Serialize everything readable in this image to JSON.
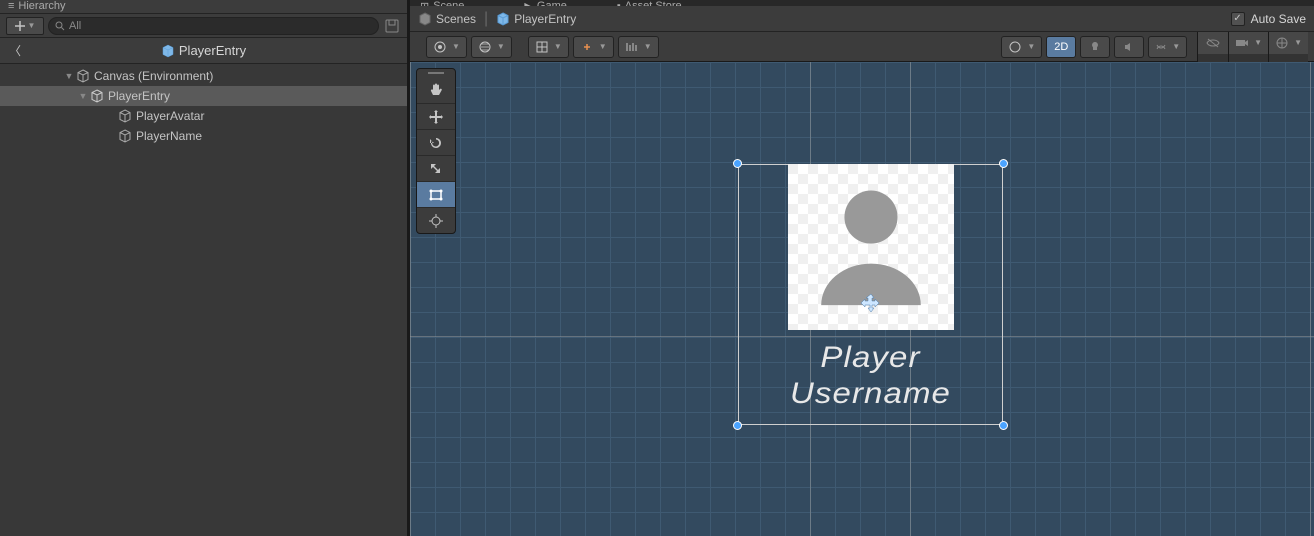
{
  "hierarchy": {
    "panel_tab": "Hierarchy",
    "search_placeholder": "All",
    "prefab_header": "PlayerEntry",
    "tree": [
      {
        "name": "Canvas (Environment)",
        "depth": 1,
        "expanded": true,
        "prefab": false
      },
      {
        "name": "PlayerEntry",
        "depth": 2,
        "expanded": true,
        "prefab": false,
        "selected": true
      },
      {
        "name": "PlayerAvatar",
        "depth": 3,
        "prefab": false
      },
      {
        "name": "PlayerName",
        "depth": 3,
        "prefab": false
      }
    ]
  },
  "scene": {
    "tabs": {
      "scene": "Scene",
      "game": "Game",
      "asset_store": "Asset Store"
    },
    "breadcrumb": {
      "root": "Scenes",
      "current": "PlayerEntry"
    },
    "autosave_label": "Auto Save",
    "autosave_checked": true,
    "toolbar": {
      "mode_2d": "2D"
    },
    "canvas": {
      "username_line1": "Player",
      "username_line2": "Username"
    }
  }
}
